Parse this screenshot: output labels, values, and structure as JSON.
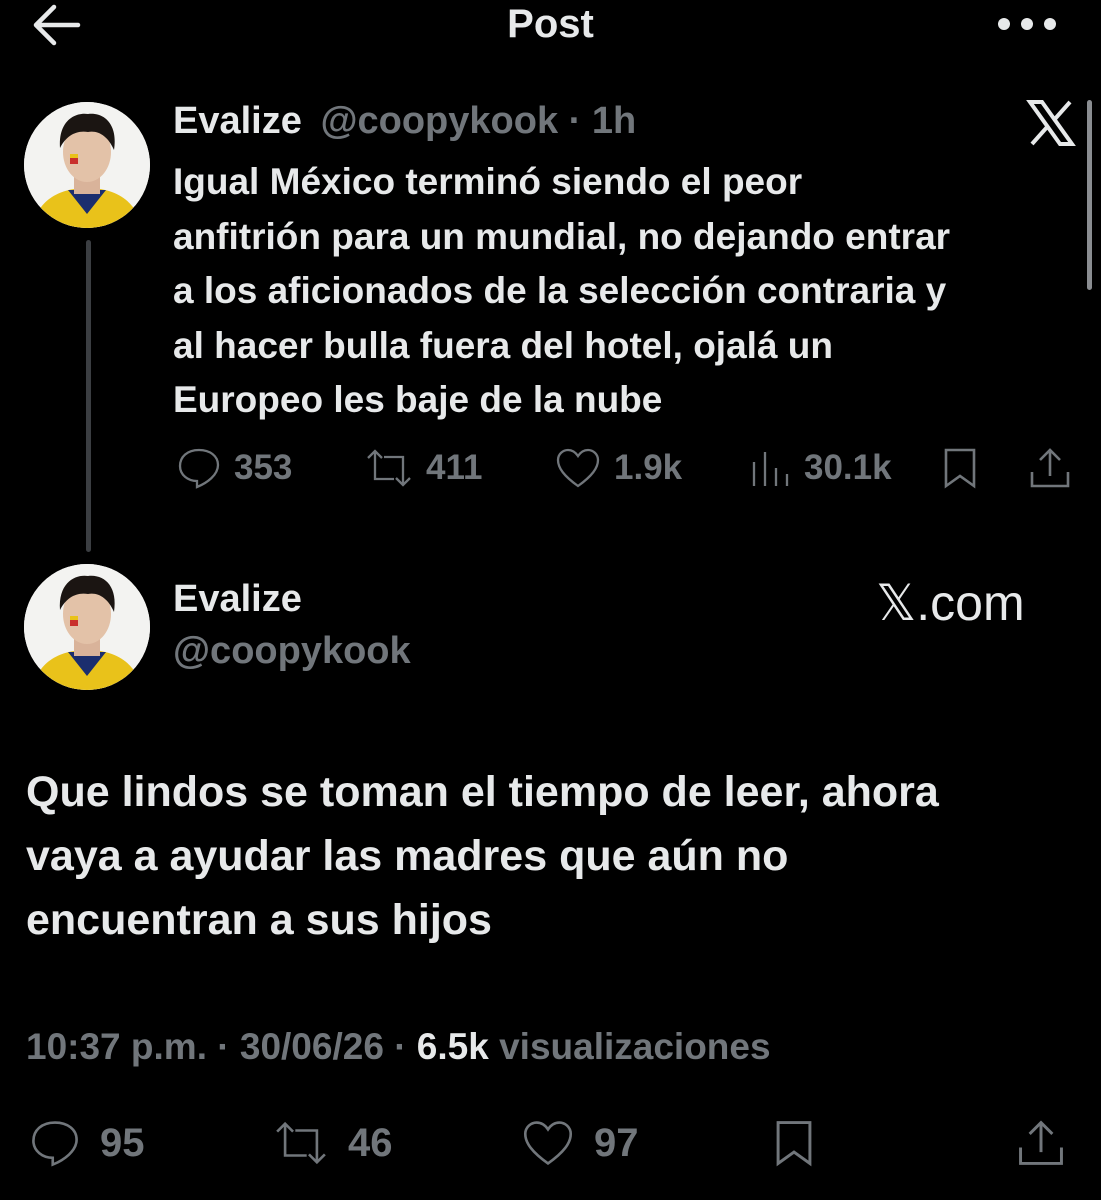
{
  "header": {
    "title": "Post"
  },
  "parent_post": {
    "author_name": "Evalize",
    "handle": "@coopykook",
    "separator": "·",
    "time": "1h",
    "text": "Igual México terminó siendo el peor\nanfitrión para un mundial, no dejando entrar\na los aficionados de la selección contraria y\nal hacer bulla fuera del hotel, ojalá un\nEuropeo les baje de la nube",
    "replies": "353",
    "reposts": "411",
    "likes": "1.9k",
    "views": "30.1k"
  },
  "main_post": {
    "author_name": "Evalize",
    "handle": "@coopykook",
    "brand_text": "𝕏.com",
    "text": "Que lindos se toman el tiempo de leer, ahora\nvaya a ayudar las madres que aún no\nencuentran a sus hijos",
    "time": "10:37 p.m.",
    "sep1": "·",
    "date": "30/06/26",
    "sep2": "·",
    "views_count": "6.5k",
    "views_label": "visualizaciones",
    "replies": "95",
    "reposts": "46",
    "likes": "97"
  },
  "icons": {
    "back": "arrow-left-icon",
    "more": "more-horizontal-icon",
    "x_logo": "x-logo-icon",
    "reply": "comment-bubble-icon",
    "repost": "repost-icon",
    "like": "heart-icon",
    "views": "analytics-bars-icon",
    "bookmark": "bookmark-icon",
    "share": "share-icon"
  },
  "colors": {
    "background": "#000000",
    "text": "#e7e9ea",
    "muted": "#71767b"
  }
}
